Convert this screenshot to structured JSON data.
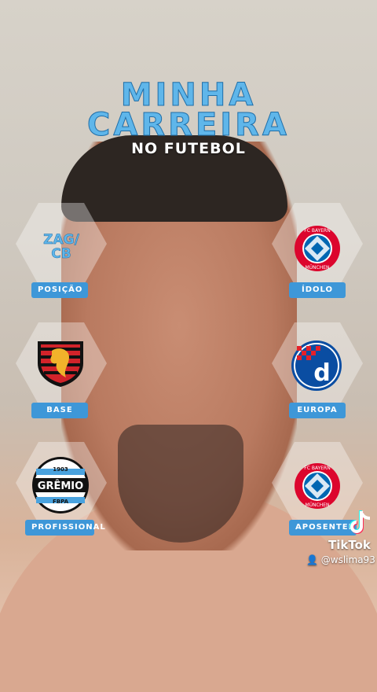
{
  "title": {
    "line1": "MINHA",
    "line2": "CARREIRA",
    "subtitle": "NO FUTEBOL"
  },
  "cards": {
    "posicao": {
      "value": "ZAG/\nCB",
      "label": "POSIÇÃO"
    },
    "idolo": {
      "label": "ÍDOLO",
      "logo": "fc-bayern-munchen-logo",
      "logo_text_top": "FC BAYERN",
      "logo_text_bottom": "MÜNCHEN"
    },
    "base": {
      "label": "BASE",
      "logo": "sport-club-recife-logo"
    },
    "europa": {
      "label": "EUROPA",
      "logo": "dinamo-zagreb-logo",
      "logo_letter": "d"
    },
    "profissional": {
      "label": "PROFISSIONAL",
      "logo": "gremio-logo",
      "year": "1903",
      "name": "GRÊMIO",
      "abbr": "FBPA"
    },
    "aposentei": {
      "label": "APOSENTEI",
      "logo": "fc-bayern-munchen-logo",
      "logo_text_top": "FC BAYERN",
      "logo_text_bottom": "MÜNCHEN"
    }
  },
  "watermark": {
    "brand": "TikTok",
    "username": "@wslima93"
  },
  "colors": {
    "accent": "#3e97d8",
    "title": "#5fb6ea",
    "bayern_red": "#dc052d",
    "bayern_blue": "#0066b2"
  }
}
